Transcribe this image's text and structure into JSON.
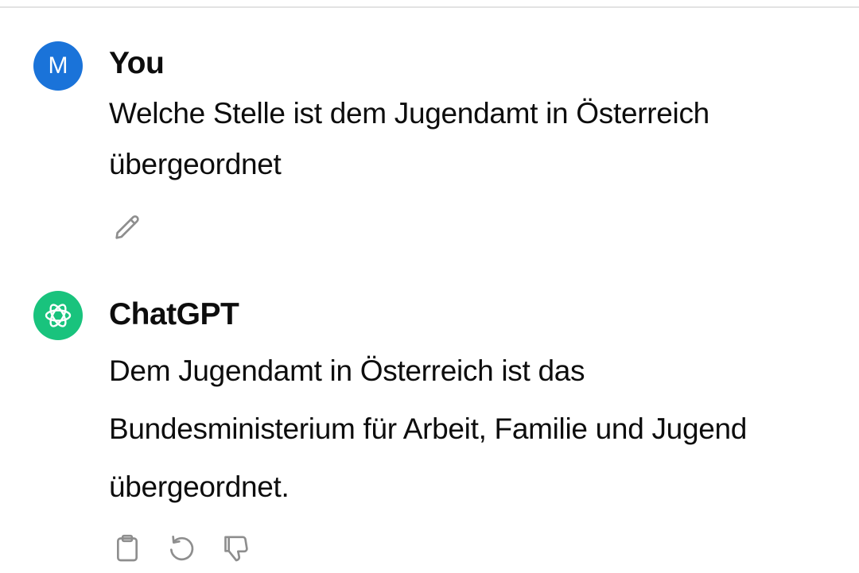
{
  "conversation": {
    "user_message": {
      "avatar_letter": "M",
      "author": "You",
      "text": "Welche Stelle ist dem Jugendamt in Österreich übergeordnet",
      "actions": [
        "pencil-icon"
      ]
    },
    "assistant_message": {
      "author": "ChatGPT",
      "text": "Dem Jugendamt in Österreich ist das Bundesministerium für Arbeit, Familie und Jugend übergeordnet.",
      "actions": [
        "clipboard-icon",
        "regenerate-icon",
        "thumbs-down-icon"
      ]
    }
  },
  "colors": {
    "user_avatar": "#1a73d9",
    "assistant_avatar": "#19c37d",
    "icon": "#8e8e8e"
  }
}
